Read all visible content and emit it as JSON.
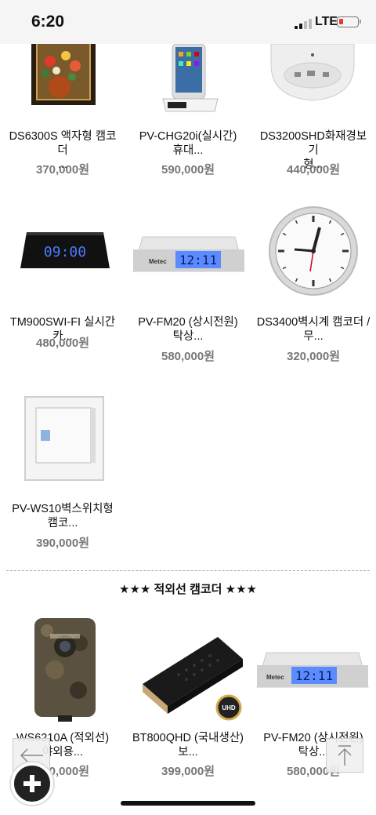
{
  "status_bar": {
    "time": "6:20",
    "network": "LTE"
  },
  "products_top": [
    {
      "name_line1": "DS6300S 액자형 캠코더",
      "name_line2": "...",
      "price": "370,000원",
      "icon": "framed-painting-camera"
    },
    {
      "name_line1": "PV-CHG20i(실시간)",
      "name_line2": "휴대...",
      "price": "590,000원",
      "icon": "phone-dock-camera"
    },
    {
      "name_line1": "DS3200SHD화재경보기",
      "name_line2": "형...",
      "price": "440,000원",
      "icon": "smoke-detector-camera"
    },
    {
      "name_line1": "TM900SWI-FI 실시간카...",
      "name_line2": "",
      "price": "480,000원",
      "icon": "alarm-clock-camera"
    },
    {
      "name_line1": "PV-FM20 (상시전원)",
      "name_line2": "탁상...",
      "price": "580,000원",
      "icon": "desk-clock-camera"
    },
    {
      "name_line1": "DS3400벽시계 캠코더 /",
      "name_line2": "무...",
      "price": "320,000원",
      "icon": "wall-clock-camera"
    },
    {
      "name_line1": "PV-WS10벽스위치형",
      "name_line2": "캠코...",
      "price": "390,000원",
      "icon": "wall-switch-camera"
    }
  ],
  "section": {
    "title": "★★★ 적외선 캠코더 ★★★"
  },
  "products_bottom": [
    {
      "name_line1": "WS6210A (적외선)",
      "name_line2": "야외용...",
      "price": "380,000원",
      "icon": "trail-camera"
    },
    {
      "name_line1": "BT800QHD (국내생산)",
      "name_line2": "보...",
      "price": "399,000원",
      "icon": "power-bank-camera",
      "badge": "UHD"
    },
    {
      "name_line1": "PV-FM20 (상시전원)",
      "name_line2": "탁상...",
      "price": "580,000원",
      "icon": "desk-clock-camera"
    }
  ],
  "clock_display": {
    "alarm": "09:00",
    "desk": "12:11",
    "brand": "Metec"
  },
  "colors": {
    "price": "#777777",
    "accent_display": "#4a7bff",
    "battery_low": "#e53935"
  }
}
